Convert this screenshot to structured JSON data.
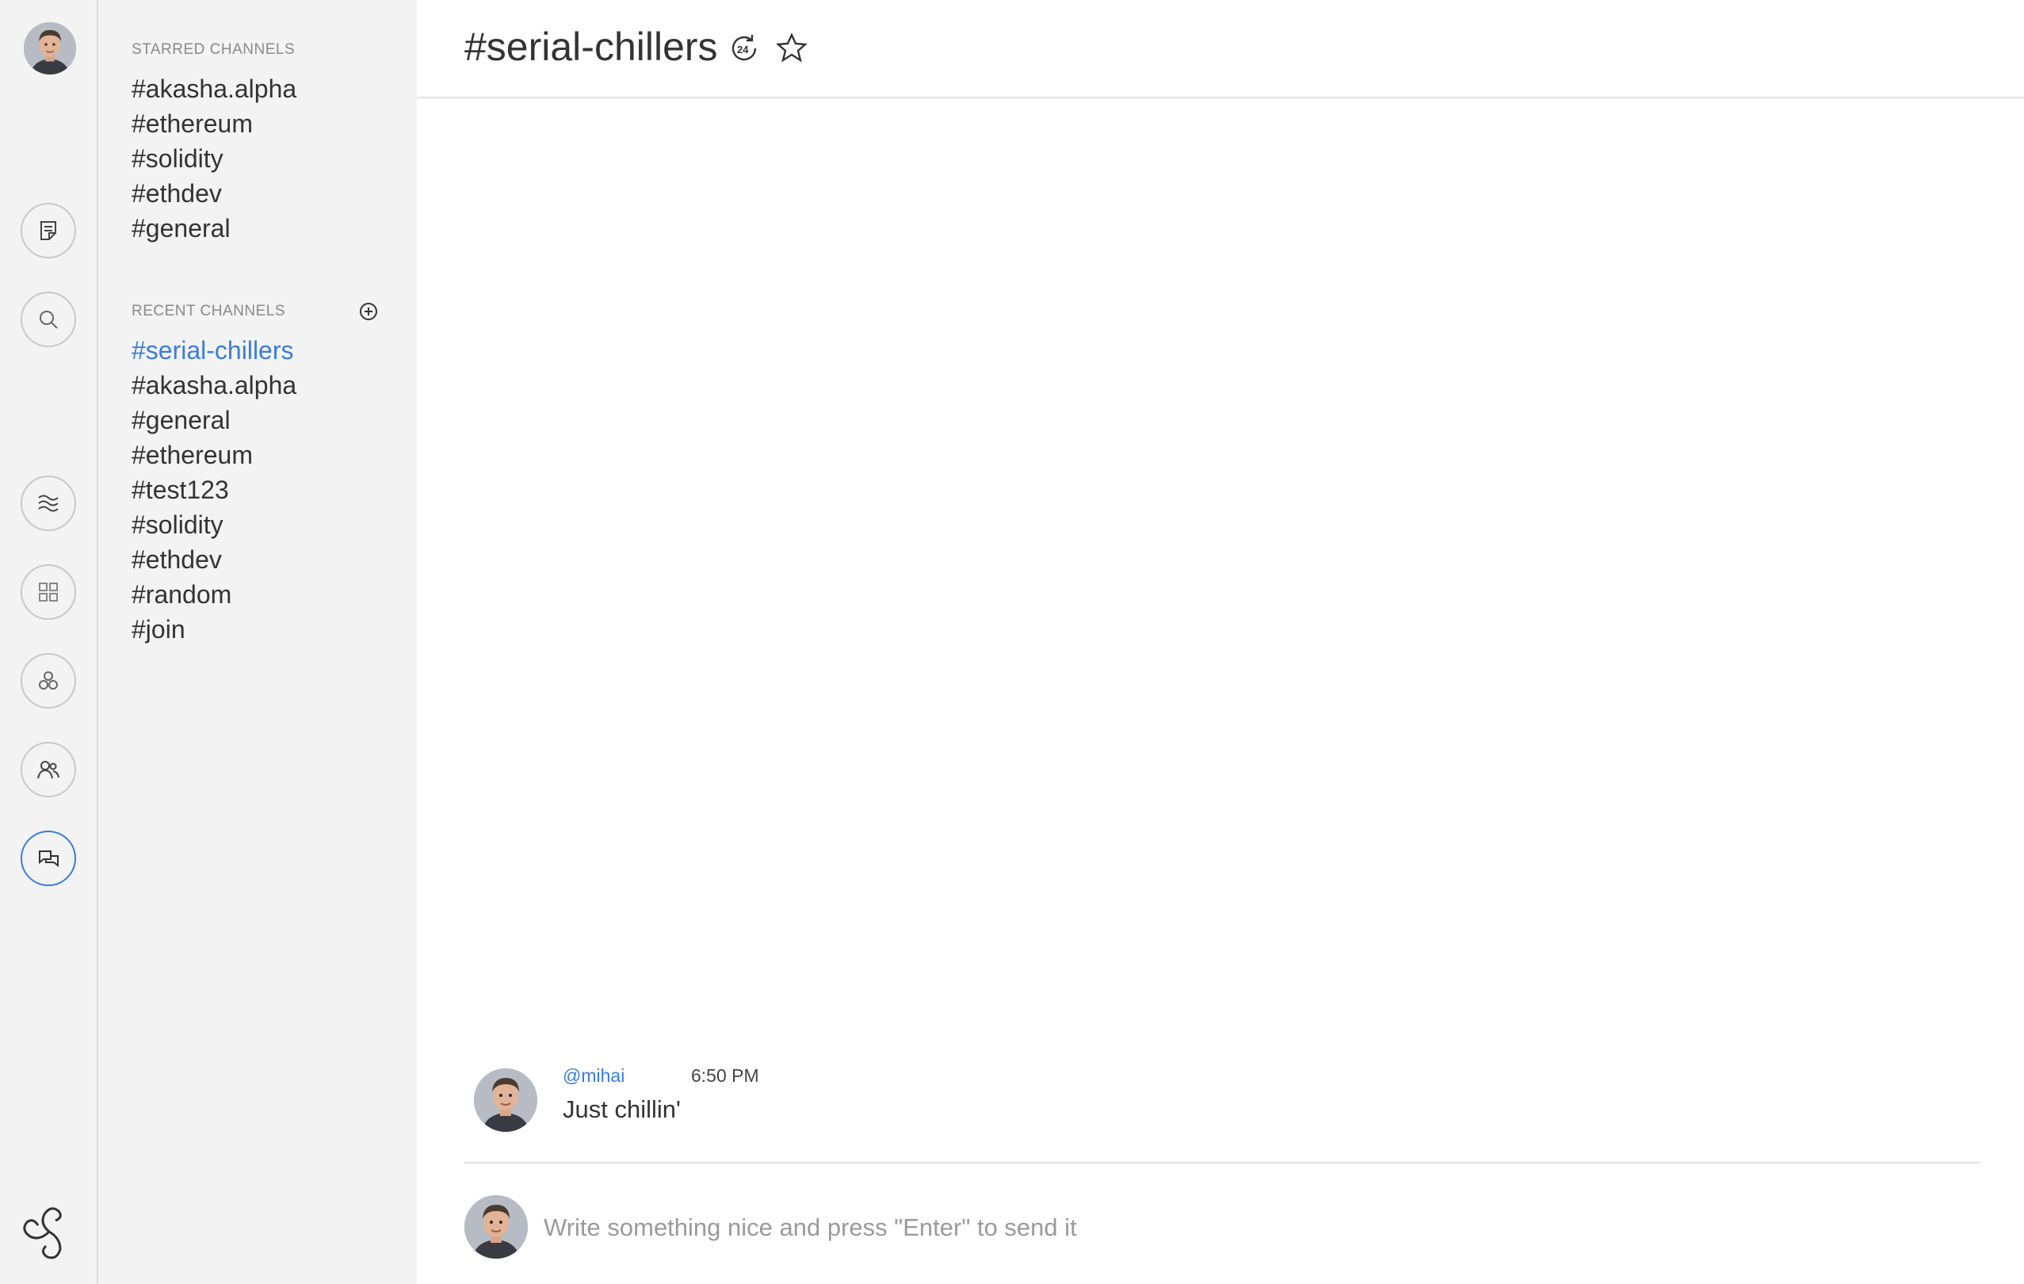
{
  "user": {
    "avatar_alt": "user avatar"
  },
  "rail": {
    "items": [
      {
        "icon": "note-icon"
      },
      {
        "icon": "search-icon"
      },
      {
        "icon": "waves-icon"
      },
      {
        "icon": "grid-icon"
      },
      {
        "icon": "communities-icon"
      },
      {
        "icon": "people-icon"
      },
      {
        "icon": "chat-icon",
        "active": true
      }
    ],
    "logo_icon": "akasha-logo-icon"
  },
  "sidebar": {
    "starred_title": "STARRED CHANNELS",
    "starred": [
      "#akasha.alpha",
      "#ethereum",
      "#solidity",
      "#ethdev",
      "#general"
    ],
    "recent_title": "RECENT CHANNELS",
    "recent": [
      "#serial-chillers",
      "#akasha.alpha",
      "#general",
      "#ethereum",
      "#test123",
      "#solidity",
      "#ethdev",
      "#random",
      "#join"
    ],
    "active_channel": "#serial-chillers"
  },
  "header": {
    "title": "#serial-chillers",
    "history_icon": "24h-history-icon",
    "star_icon": "star-icon"
  },
  "messages": [
    {
      "author": "@mihai",
      "time": "6:50 PM",
      "text": "Just chillin'"
    }
  ],
  "composer": {
    "placeholder": "Write something nice and press \"Enter\" to send it",
    "value": ""
  },
  "colors": {
    "accent": "#3b7cd9",
    "sidebar_bg": "#f3f3f3"
  }
}
